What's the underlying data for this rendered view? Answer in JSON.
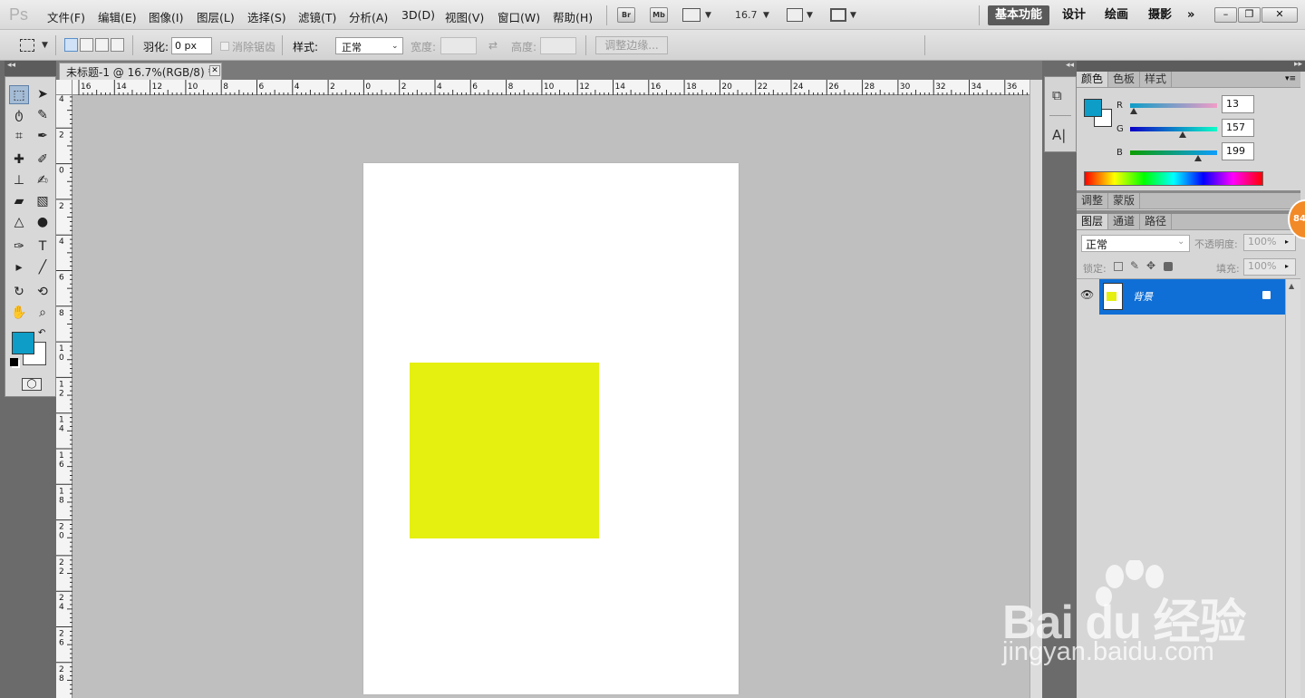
{
  "app": {
    "logo": "Ps"
  },
  "menu": [
    "文件(F)",
    "编辑(E)",
    "图像(I)",
    "图层(L)",
    "选择(S)",
    "滤镜(T)",
    "分析(A)",
    "3D(D)",
    "视图(V)",
    "窗口(W)",
    "帮助(H)"
  ],
  "appbar": {
    "bridge": "Br",
    "minibridge": "Mb",
    "zoom": "16.7"
  },
  "workspaces": [
    "基本功能",
    "设计",
    "绘画",
    "摄影"
  ],
  "workspace_more": "»",
  "options": {
    "feather_label": "羽化:",
    "feather_value": "0 px",
    "antialias_label": "消除锯齿",
    "style_label": "样式:",
    "style_value": "正常",
    "width_label": "宽度:",
    "height_label": "高度:",
    "refine_edge": "调整边缘..."
  },
  "document": {
    "tab_title": "未标题-1 @ 16.7%(RGB/8) *"
  },
  "ruler": {
    "h_labels": [
      "16",
      "14",
      "12",
      "10",
      "8",
      "6",
      "4",
      "2",
      "0",
      "2",
      "4",
      "6",
      "8",
      "10",
      "12",
      "14",
      "16",
      "18",
      "20",
      "22",
      "24",
      "26",
      "28",
      "30",
      "32",
      "34",
      "36"
    ],
    "v_labels": [
      "4",
      "2",
      "0",
      "2",
      "4",
      "6",
      "8",
      "10",
      "12",
      "14",
      "16",
      "18",
      "20",
      "22",
      "24",
      "26",
      "28"
    ]
  },
  "colors": {
    "foreground": "#0d9dc7",
    "background": "#ffffff",
    "canvas_shape": "#e5ef10",
    "layer_selected": "#0f6fd6"
  },
  "color_panel": {
    "tabs": [
      "颜色",
      "色板",
      "样式"
    ],
    "r_label": "R",
    "r_value": "13",
    "g_label": "G",
    "g_value": "157",
    "b_label": "B",
    "b_value": "199"
  },
  "adjust_panel": {
    "tabs": [
      "调整",
      "蒙版"
    ]
  },
  "layers_panel": {
    "tabs": [
      "图层",
      "通道",
      "路径"
    ],
    "blend_mode": "正常",
    "opacity_label": "不透明度:",
    "opacity_value": "100%",
    "lock_label": "锁定:",
    "fill_label": "填充:",
    "fill_value": "100%",
    "layer_name": "背景"
  },
  "badge": "84",
  "watermark": {
    "brand": "Bai du 经验",
    "url": "jingyan.baidu.com"
  }
}
